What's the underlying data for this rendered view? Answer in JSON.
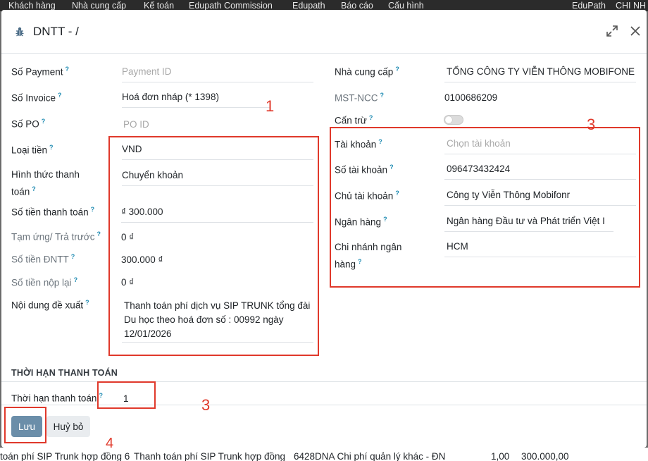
{
  "navbar": {
    "items": [
      "Khách hàng",
      "Nhà cung cấp",
      "Kế toán",
      "Edupath Commission",
      "Edupath",
      "Báo cáo",
      "Cấu hình"
    ],
    "right": [
      "EduPath",
      "CHI NH"
    ]
  },
  "dialog": {
    "title": "DNTT - /",
    "q": "?"
  },
  "left": {
    "payment": {
      "label": "Số Payment",
      "placeholder": "Payment ID"
    },
    "invoice": {
      "label": "Số Invoice",
      "value": "Hoá đơn nháp (* 1398)"
    },
    "po": {
      "label": "Số PO",
      "placeholder": "PO ID"
    },
    "currency": {
      "label": "Loại tiền",
      "value": "VND"
    },
    "method": {
      "label": "Hình thức thanh toán",
      "value": "Chuyển khoản"
    },
    "amount": {
      "label": "Số tiền thanh toán",
      "value": "₫ 300.000"
    },
    "advance": {
      "label": "Tạm ứng/ Trả trước",
      "value": "0 ₫"
    },
    "dntt_amount": {
      "label": "Số tiền ĐNTT",
      "value": "300.000 ₫"
    },
    "refund": {
      "label": "Số tiền nộp lại",
      "value": "0 ₫"
    },
    "content": {
      "label": "Nội dung đề xuất",
      "value": "Thanh toán phí dịch vụ SIP TRUNK tổng đài Du học theo hoá đơn số : 00992 ngày 12/01/2026"
    }
  },
  "right": {
    "vendor": {
      "label": "Nhà cung cấp",
      "value": "TỔNG CÔNG TY VIỄN THÔNG MOBIFONE"
    },
    "tax": {
      "label": "MST-NCC",
      "value": "0100686209"
    },
    "offset": {
      "label": "Cấn trừ"
    },
    "account": {
      "label": "Tài khoản",
      "placeholder": "Chọn tài khoản"
    },
    "account_no": {
      "label": "Số tài khoản",
      "value": "096473432424"
    },
    "holder": {
      "label": "Chủ tài khoản",
      "value": "Công ty  Viễn Thông Mobifonr"
    },
    "bank": {
      "label": "Ngân hàng",
      "value": "Ngân hàng Đầu tư và Phát triển Việt I"
    },
    "branch": {
      "label": "Chi nhánh ngân hàng",
      "value": "HCM"
    }
  },
  "terms": {
    "section": "THỜI HẠN THANH TOÁN",
    "label": "Thời hạn thanh toán",
    "value": "1"
  },
  "footer": {
    "save": "Lưu",
    "cancel": "Huỷ bỏ"
  },
  "annotations": {
    "a1": "1",
    "a3a": "3",
    "a3b": "3",
    "a4": "4",
    "color": "#e0392b"
  },
  "background_row": {
    "col1": "toán phí SIP Trunk hợp đồng 6",
    "col2": "Thanh toán phí SIP Trunk  hợp đồng",
    "col3": "6428DNA Chi phí quản lý khác - ĐN",
    "col4": "1,00",
    "col5": "300.000,00"
  }
}
